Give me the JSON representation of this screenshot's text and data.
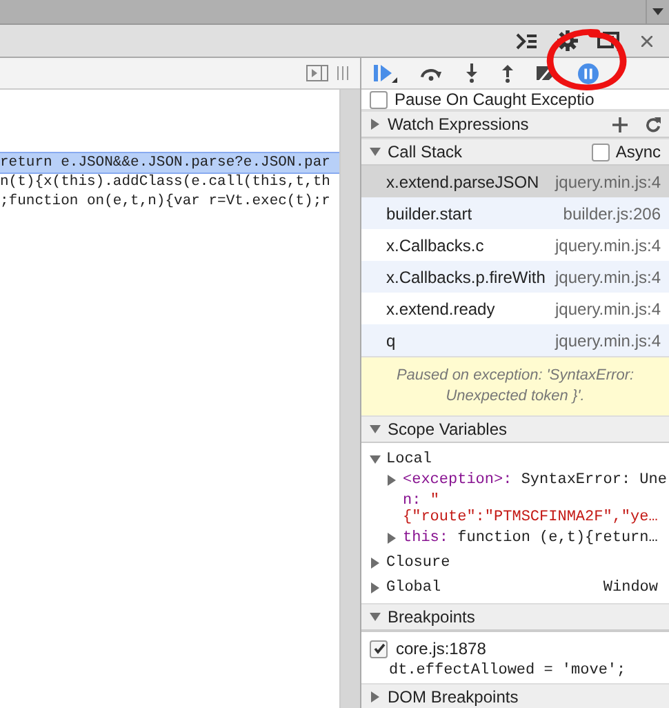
{
  "code_lines": [
    {
      "text": "return e.JSON&&e.JSON.parse?e.JSON.par",
      "selected": true
    },
    {
      "text": "n(t){x(this).addClass(e.call(this,t,th",
      "selected": false
    },
    {
      "text": ";function on(e,t,n){var r=Vt.exec(t);r",
      "selected": false
    }
  ],
  "pause_on_caught_exceptions": {
    "label": "Pause On Caught Exceptio",
    "checked": false
  },
  "watch_expressions": {
    "title": "Watch Expressions",
    "expanded": false
  },
  "call_stack": {
    "title": "Call Stack",
    "expanded": true,
    "async": {
      "label": "Async",
      "checked": false
    },
    "frames": [
      {
        "function": "x.extend.parseJSON",
        "location": "jquery.min.js:4",
        "selected": true
      },
      {
        "function": "builder.start",
        "location": "builder.js:206",
        "selected": false
      },
      {
        "function": "x.Callbacks.c",
        "location": "jquery.min.js:4",
        "selected": false
      },
      {
        "function": "x.Callbacks.p.fireWith",
        "location": "jquery.min.js:4",
        "selected": false
      },
      {
        "function": "x.extend.ready",
        "location": "jquery.min.js:4",
        "selected": false
      },
      {
        "function": "q",
        "location": "jquery.min.js:4",
        "selected": false
      }
    ]
  },
  "paused_message": "Paused on exception: 'SyntaxError: Unexpected token }'.",
  "scope_variables": {
    "title": "Scope Variables",
    "expanded": true,
    "scopes": [
      {
        "name": "Local",
        "expanded": true,
        "children": [
          {
            "name": "<exception>:",
            "value": "SyntaxError: Une",
            "kind": "object",
            "expanded": false
          },
          {
            "name": "n:",
            "value": "\"\n{\"route\":\"PTMSCFINMA2F\",\"ye…",
            "kind": "string"
          },
          {
            "name": "this:",
            "value": "function (e,t){return…",
            "kind": "object",
            "expanded": false
          }
        ]
      },
      {
        "name": "Closure",
        "expanded": false
      },
      {
        "name": "Global",
        "expanded": false,
        "value": "Window"
      }
    ]
  },
  "breakpoints": {
    "title": "Breakpoints",
    "expanded": true,
    "items": [
      {
        "location": "core.js:1878",
        "code": "dt.effectAllowed = 'move';",
        "checked": true
      }
    ]
  },
  "dom_breakpoints": {
    "title": "DOM Breakpoints",
    "expanded": false
  }
}
